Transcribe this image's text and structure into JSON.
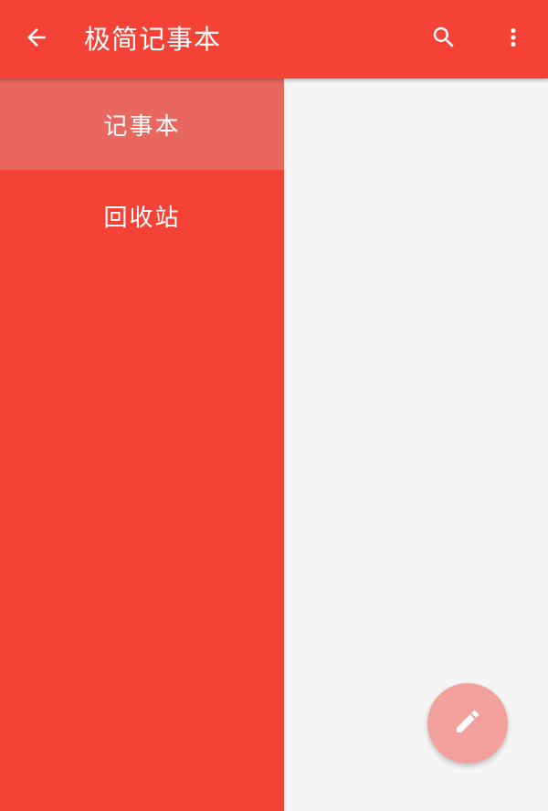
{
  "app_bar": {
    "title": "极简记事本",
    "back_icon": "arrow-back-icon",
    "search_icon": "search-icon",
    "more_icon": "more-vert-icon",
    "color": "#f44336"
  },
  "drawer": {
    "items": [
      {
        "label": "记事本",
        "active": true
      },
      {
        "label": "回收站",
        "active": false
      }
    ],
    "background": "#f44336",
    "active_background": "#e8675f"
  },
  "fab": {
    "icon": "pencil-edit-icon",
    "color": "#f2a19c"
  },
  "content": {
    "background": "#f5f5f5"
  }
}
